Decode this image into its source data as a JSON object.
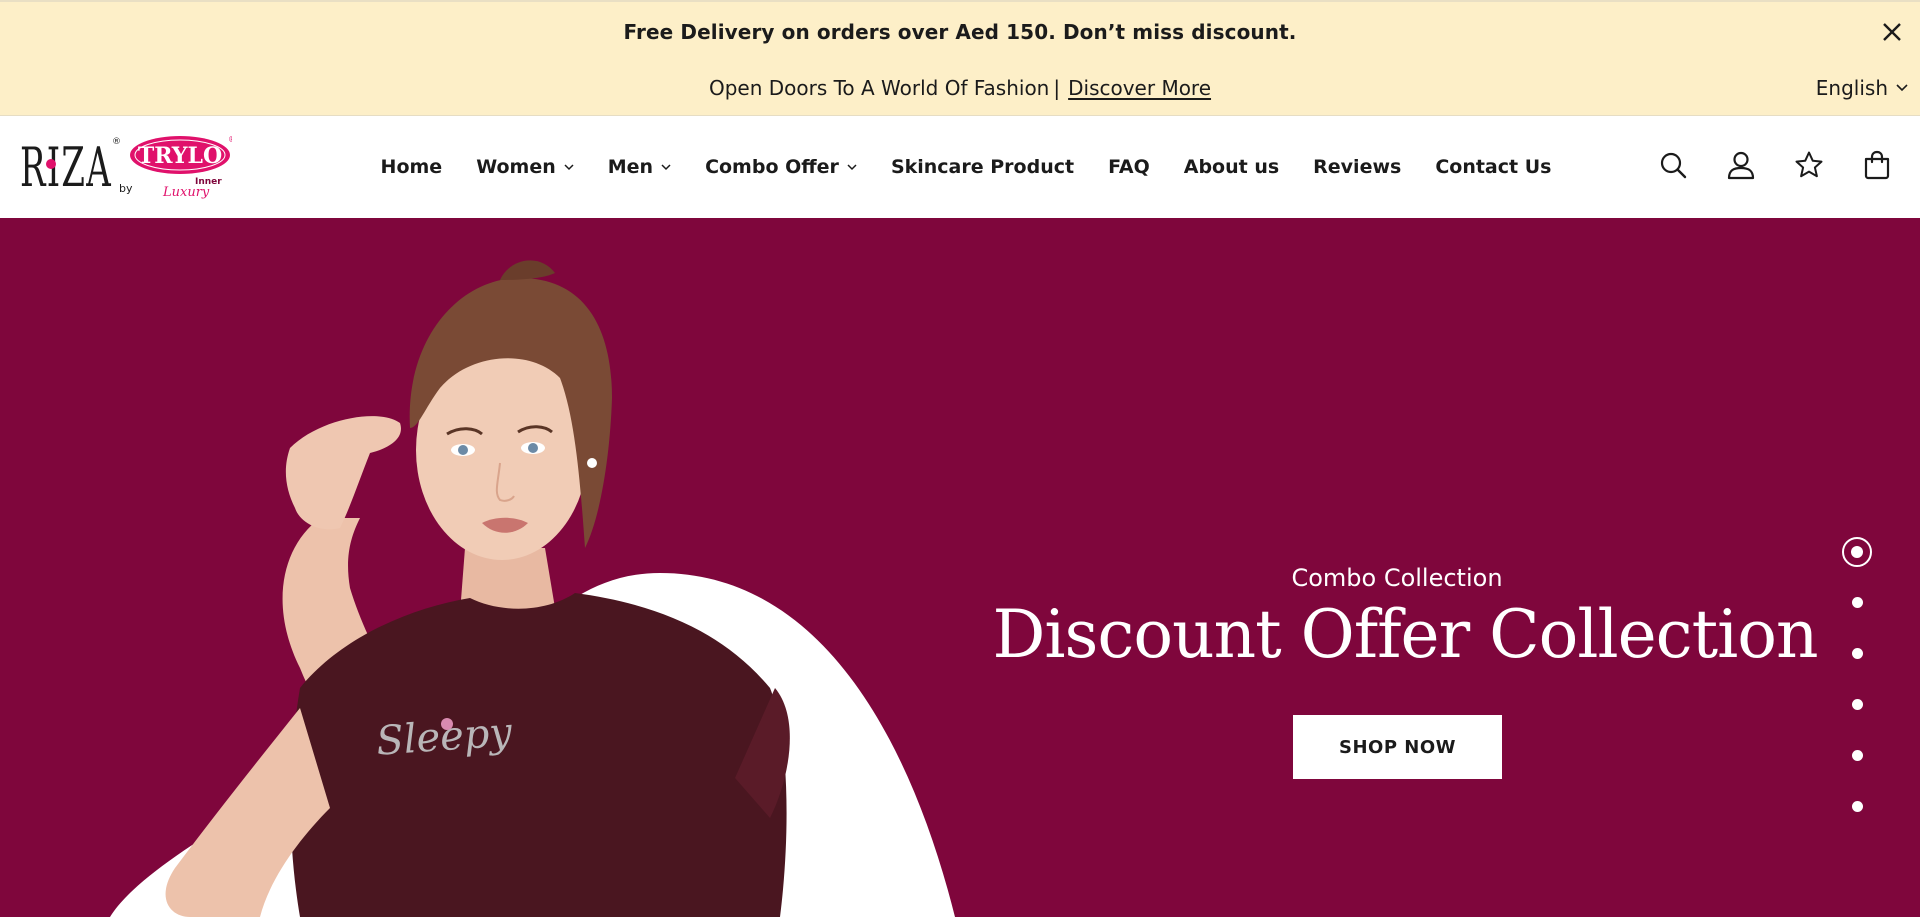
{
  "announcement": {
    "line1": "Free Delivery on orders over Aed 150. Don’t miss discount.",
    "line2_text": "Open Doors To A World Of Fashion",
    "line2_separator": "|",
    "line2_link": "Discover More",
    "language": "English",
    "close_icon": "close-icon",
    "language_icon": "chevron-down-icon"
  },
  "logo": {
    "brand": "RIZA",
    "by": "by",
    "partner": "TRYLO",
    "tagline_top": "Inner",
    "tagline_bottom": "Luxury"
  },
  "nav": {
    "items": [
      {
        "label": "Home",
        "has_dropdown": false
      },
      {
        "label": "Women",
        "has_dropdown": true
      },
      {
        "label": "Men",
        "has_dropdown": true
      },
      {
        "label": "Combo Offer",
        "has_dropdown": true
      },
      {
        "label": "Skincare Product",
        "has_dropdown": false
      },
      {
        "label": "FAQ",
        "has_dropdown": false
      },
      {
        "label": "About us",
        "has_dropdown": false
      },
      {
        "label": "Reviews",
        "has_dropdown": false
      },
      {
        "label": "Contact Us",
        "has_dropdown": false
      }
    ]
  },
  "header_icons": [
    "search-icon",
    "account-icon",
    "wishlist-star-icon",
    "cart-bag-icon"
  ],
  "hero": {
    "subtitle": "Combo Collection",
    "title": "Discount Offer Collection",
    "button": "SHOP NOW",
    "shirt_text": "Sleepy",
    "slide_count": 6,
    "active_slide": 1
  },
  "colors": {
    "announcement_bg": "#fdefc8",
    "hero_bg": "#7f063c",
    "brand_pink": "#e0116b",
    "shirt": "#4a1620"
  }
}
